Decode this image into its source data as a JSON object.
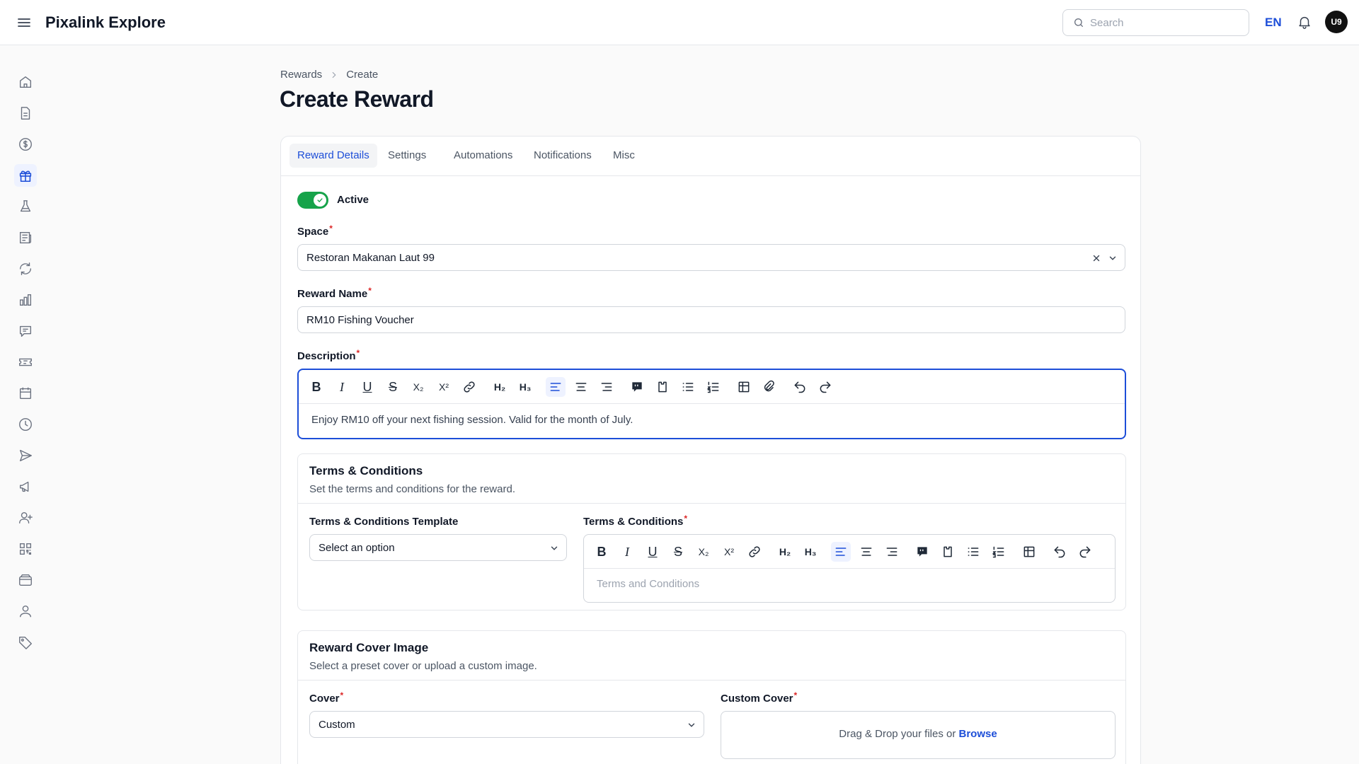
{
  "header": {
    "app_title": "Pixalink Explore",
    "search_placeholder": "Search",
    "language": "EN",
    "avatar_initials": "U9"
  },
  "sidebar": {
    "items": [
      {
        "icon": "home-icon"
      },
      {
        "icon": "document-icon"
      },
      {
        "icon": "dollar-icon"
      },
      {
        "icon": "gift-icon",
        "active": true
      },
      {
        "icon": "flask-icon"
      },
      {
        "icon": "news-icon"
      },
      {
        "icon": "refresh-icon"
      },
      {
        "icon": "bar-chart-icon"
      },
      {
        "icon": "chat-icon"
      },
      {
        "icon": "ticket-icon"
      },
      {
        "icon": "calendar-icon"
      },
      {
        "icon": "clock-icon"
      },
      {
        "icon": "send-icon"
      },
      {
        "icon": "megaphone-icon"
      },
      {
        "icon": "user-plus-icon"
      },
      {
        "icon": "qr-code-icon"
      },
      {
        "icon": "wallet-icon"
      },
      {
        "icon": "user-icon"
      },
      {
        "icon": "tag-icon"
      }
    ]
  },
  "breadcrumb": {
    "parent": "Rewards",
    "current": "Create"
  },
  "page": {
    "title": "Create Reward"
  },
  "tabs": [
    {
      "label": "Reward Details",
      "active": true
    },
    {
      "label": "Settings"
    },
    {
      "label": "Automations"
    },
    {
      "label": "Notifications"
    },
    {
      "label": "Misc"
    }
  ],
  "form": {
    "active_label": "Active",
    "active_on": true,
    "space_label": "Space",
    "space_value": "Restoran Makanan Laut 99",
    "reward_name_label": "Reward Name",
    "reward_name_value": "RM10 Fishing Voucher",
    "description_label": "Description",
    "description_value": "Enjoy RM10 off your next fishing session. Valid for the month of July.",
    "required_mark": "*"
  },
  "terms": {
    "title": "Terms & Conditions",
    "description": "Set the terms and conditions for the reward.",
    "template_label": "Terms & Conditions Template",
    "template_value": "Select an option",
    "editor_label": "Terms & Conditions",
    "editor_placeholder": "Terms and Conditions"
  },
  "cover": {
    "title": "Reward Cover Image",
    "description": "Select a preset cover or upload a custom image.",
    "cover_label": "Cover",
    "cover_value": "Custom",
    "custom_cover_label": "Custom Cover",
    "dropzone_text": "Drag & Drop your files or",
    "browse_label": "Browse"
  },
  "toolbar": {
    "h2": "H₂",
    "h3": "H₃",
    "subscript": "X₂",
    "superscript": "X²",
    "bold": "B",
    "italic": "I",
    "underline": "U",
    "strike": "S"
  },
  "colors": {
    "accent": "#1d4ed8",
    "toggle_on": "#16a34a",
    "required": "#dc2626"
  }
}
